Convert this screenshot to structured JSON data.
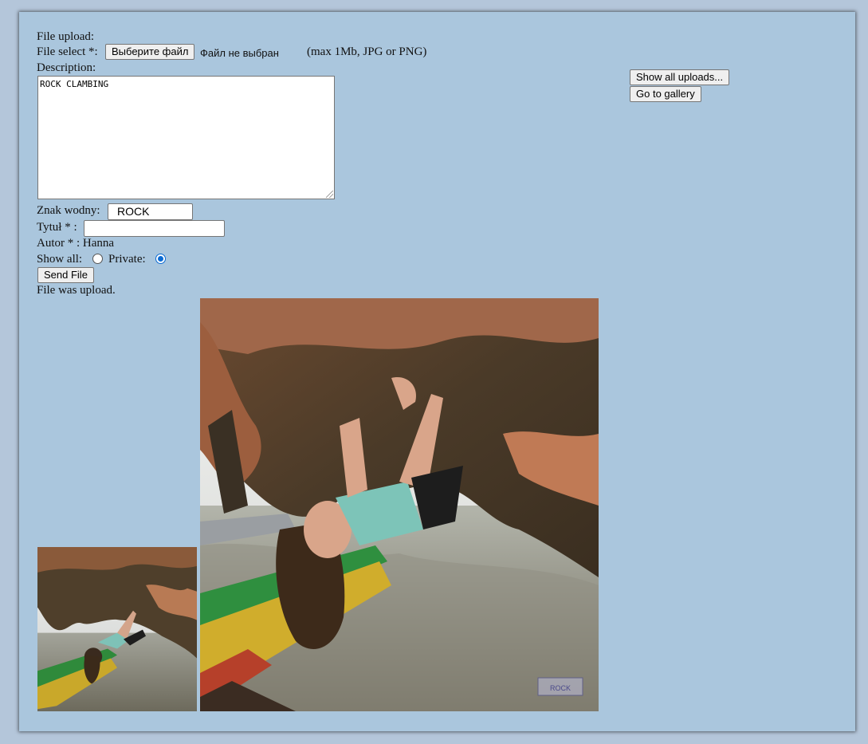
{
  "form": {
    "heading": "File upload:",
    "file_select_label": "File select *:",
    "file_button_label": "Выберите файл",
    "file_status": "Файл не выбран",
    "file_hint": "(max 1Mb, JPG or PNG)",
    "description_label": "Description:",
    "description_value": "ROCK CLAMBING",
    "watermark_label": "Znak wodny:",
    "watermark_value": "ROCK",
    "title_label": "Tytuł * :",
    "title_value": "",
    "author_label": "Autor * : Hanna",
    "show_all_label": "Show all:",
    "private_label": "Private:",
    "visibility_selected": "private",
    "send_button_label": "Send File",
    "status_message": "File was upload."
  },
  "side": {
    "show_all_uploads_label": "Show all uploads...",
    "go_to_gallery_label": "Go to gallery"
  },
  "images": {
    "thumbnail_subject": "rock climber hanging upside down under cliff overhang above water",
    "full_subject": "rock climber hanging upside down under cliff overhang above water",
    "watermark_text": "ROCK"
  },
  "colors": {
    "page_bg": "#b4c6da",
    "panel_bg": "#aac6dd",
    "radio_accent": "#0b6bd3"
  }
}
